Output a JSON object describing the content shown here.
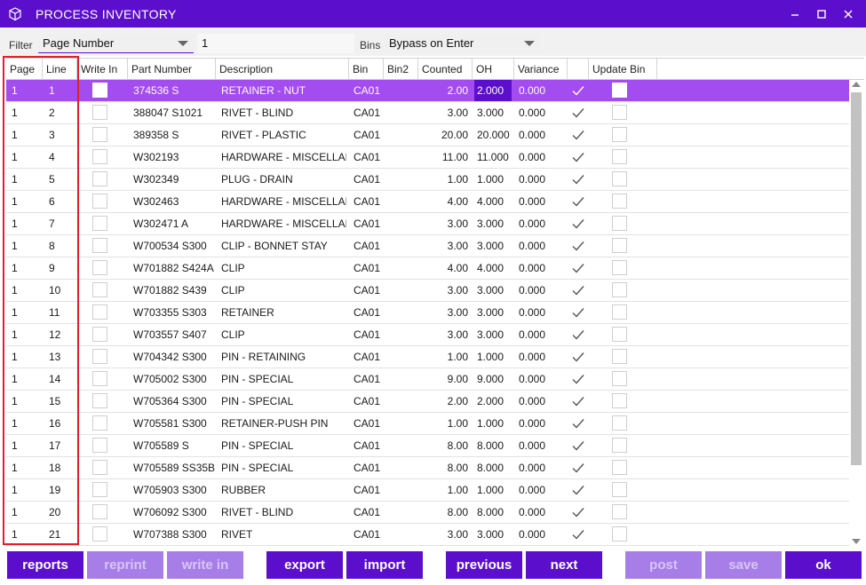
{
  "window": {
    "title": "PROCESS INVENTORY",
    "app_icon": "box-icon",
    "controls": [
      "minimize-icon",
      "maximize-icon",
      "close-icon"
    ],
    "accent_color": "#5b0fcc",
    "selected_row_color": "#a34cf0"
  },
  "filterbar": {
    "filter_label": "Filter",
    "filter_value": "Page Number",
    "filter_text": "1",
    "bins_label": "Bins",
    "bins_value": "Bypass on Enter"
  },
  "grid": {
    "columns": [
      "Page",
      "Line",
      "Write In",
      "Part Number",
      "Description",
      "Bin",
      "Bin2",
      "Counted",
      "OH",
      "Variance",
      "",
      "Update Bin"
    ],
    "rows": [
      {
        "page": "1",
        "line": "1",
        "part": "374536 S",
        "desc": "RETAINER - NUT",
        "bin": "CA01",
        "counted": "2.00",
        "oh": "2.000",
        "variance": "0.000"
      },
      {
        "page": "1",
        "line": "2",
        "part": "388047 S1021",
        "desc": "RIVET - BLIND",
        "bin": "CA01",
        "counted": "3.00",
        "oh": "3.000",
        "variance": "0.000"
      },
      {
        "page": "1",
        "line": "3",
        "part": "389358 S",
        "desc": "RIVET - PLASTIC",
        "bin": "CA01",
        "counted": "20.00",
        "oh": "20.000",
        "variance": "0.000"
      },
      {
        "page": "1",
        "line": "4",
        "part": "W302193",
        "desc": "HARDWARE - MISCELLAN",
        "bin": "CA01",
        "counted": "11.00",
        "oh": "11.000",
        "variance": "0.000"
      },
      {
        "page": "1",
        "line": "5",
        "part": "W302349",
        "desc": "PLUG - DRAIN",
        "bin": "CA01",
        "counted": "1.00",
        "oh": "1.000",
        "variance": "0.000"
      },
      {
        "page": "1",
        "line": "6",
        "part": "W302463",
        "desc": "HARDWARE - MISCELLAN",
        "bin": "CA01",
        "counted": "4.00",
        "oh": "4.000",
        "variance": "0.000"
      },
      {
        "page": "1",
        "line": "7",
        "part": "W302471 A",
        "desc": "HARDWARE - MISCELLAN",
        "bin": "CA01",
        "counted": "3.00",
        "oh": "3.000",
        "variance": "0.000"
      },
      {
        "page": "1",
        "line": "8",
        "part": "W700534 S300",
        "desc": "CLIP - BONNET STAY",
        "bin": "CA01",
        "counted": "3.00",
        "oh": "3.000",
        "variance": "0.000"
      },
      {
        "page": "1",
        "line": "9",
        "part": "W701882 S424A",
        "desc": "CLIP",
        "bin": "CA01",
        "counted": "4.00",
        "oh": "4.000",
        "variance": "0.000"
      },
      {
        "page": "1",
        "line": "10",
        "part": "W701882 S439",
        "desc": "CLIP",
        "bin": "CA01",
        "counted": "3.00",
        "oh": "3.000",
        "variance": "0.000"
      },
      {
        "page": "1",
        "line": "11",
        "part": "W703355 S303",
        "desc": "RETAINER",
        "bin": "CA01",
        "counted": "3.00",
        "oh": "3.000",
        "variance": "0.000"
      },
      {
        "page": "1",
        "line": "12",
        "part": "W703557 S407",
        "desc": "CLIP",
        "bin": "CA01",
        "counted": "3.00",
        "oh": "3.000",
        "variance": "0.000"
      },
      {
        "page": "1",
        "line": "13",
        "part": "W704342 S300",
        "desc": "PIN - RETAINING",
        "bin": "CA01",
        "counted": "1.00",
        "oh": "1.000",
        "variance": "0.000"
      },
      {
        "page": "1",
        "line": "14",
        "part": "W705002 S300",
        "desc": "PIN - SPECIAL",
        "bin": "CA01",
        "counted": "9.00",
        "oh": "9.000",
        "variance": "0.000"
      },
      {
        "page": "1",
        "line": "15",
        "part": "W705364 S300",
        "desc": "PIN - SPECIAL",
        "bin": "CA01",
        "counted": "2.00",
        "oh": "2.000",
        "variance": "0.000"
      },
      {
        "page": "1",
        "line": "16",
        "part": "W705581 S300",
        "desc": "RETAINER-PUSH PIN",
        "bin": "CA01",
        "counted": "1.00",
        "oh": "1.000",
        "variance": "0.000"
      },
      {
        "page": "1",
        "line": "17",
        "part": "W705589 S",
        "desc": "PIN - SPECIAL",
        "bin": "CA01",
        "counted": "8.00",
        "oh": "8.000",
        "variance": "0.000"
      },
      {
        "page": "1",
        "line": "18",
        "part": "W705589 SS35B",
        "desc": "PIN - SPECIAL",
        "bin": "CA01",
        "counted": "8.00",
        "oh": "8.000",
        "variance": "0.000"
      },
      {
        "page": "1",
        "line": "19",
        "part": "W705903 S300",
        "desc": "RUBBER",
        "bin": "CA01",
        "counted": "1.00",
        "oh": "1.000",
        "variance": "0.000"
      },
      {
        "page": "1",
        "line": "20",
        "part": "W706092 S300",
        "desc": "RIVET - BLIND",
        "bin": "CA01",
        "counted": "8.00",
        "oh": "8.000",
        "variance": "0.000"
      },
      {
        "page": "1",
        "line": "21",
        "part": "W707388 S300",
        "desc": "RIVET",
        "bin": "CA01",
        "counted": "3.00",
        "oh": "3.000",
        "variance": "0.000"
      }
    ]
  },
  "footer": {
    "buttons": [
      {
        "label": "reports",
        "enabled": true
      },
      {
        "label": "reprint",
        "enabled": false
      },
      {
        "label": "write in",
        "enabled": false
      },
      {
        "label": "export",
        "enabled": true
      },
      {
        "label": "import",
        "enabled": true
      },
      {
        "label": "previous",
        "enabled": true
      },
      {
        "label": "next",
        "enabled": true
      },
      {
        "label": "post",
        "enabled": false
      },
      {
        "label": "save",
        "enabled": false
      },
      {
        "label": "ok",
        "enabled": true
      }
    ]
  }
}
